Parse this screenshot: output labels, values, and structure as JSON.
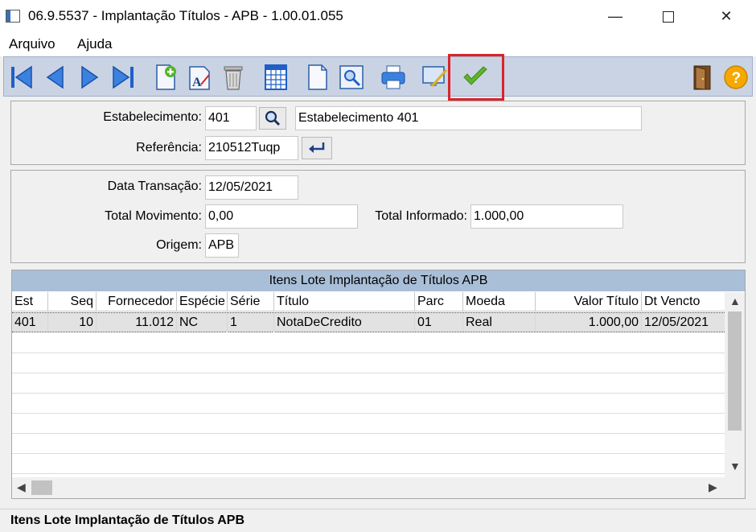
{
  "window": {
    "title": "06.9.5537 - Implantação Títulos - APB - 1.00.01.055",
    "minimize": "—",
    "close": "✕"
  },
  "menu": {
    "items": [
      "Arquivo",
      "Ajuda"
    ]
  },
  "toolbar": {
    "buttons": [
      "first-record",
      "previous-record",
      "next-record",
      "last-record",
      "new-record",
      "edit-record",
      "delete-record",
      "table-view",
      "new-document",
      "preview",
      "print",
      "edit-screen",
      "confirm-ok",
      "exit-door",
      "help-question"
    ]
  },
  "header_panel": {
    "estabelecimento_label": "Estabelecimento:",
    "estabelecimento_code": "401",
    "estabelecimento_name": "Estabelecimento 401",
    "referencia_label": "Referência:",
    "referencia_value": "210512Tuqp"
  },
  "transaction_panel": {
    "data_label": "Data Transação:",
    "data_value": "12/05/2021",
    "total_mov_label": "Total  Movimento:",
    "total_mov_value": "0,00",
    "total_inf_label": "Total Informado:",
    "total_inf_value": "1.000,00",
    "origem_label": "Origem:",
    "origem_value": "APB"
  },
  "grid": {
    "caption": "Itens Lote Implantação de Títulos APB",
    "columns": [
      "Est",
      "Seq",
      "Fornecedor",
      "Espécie",
      "Série",
      "Título",
      "Parc",
      "Moeda",
      "Valor Título",
      "Dt Vencto"
    ],
    "rows": [
      [
        "401",
        "10",
        "11.012",
        "NC",
        "1",
        "NotaDeCredito",
        "01",
        "Real",
        "1.000,00",
        "12/05/2021"
      ]
    ]
  },
  "status": {
    "text": "Itens Lote Implantação de Títulos APB"
  },
  "colors": {
    "toolbar_bg": "#c9d3e3",
    "grid_caption_bg": "#a9bfd8",
    "highlight_border": "#d9242a",
    "icon_blue": "#1f5fc8",
    "check_green": "#5fb52a"
  }
}
